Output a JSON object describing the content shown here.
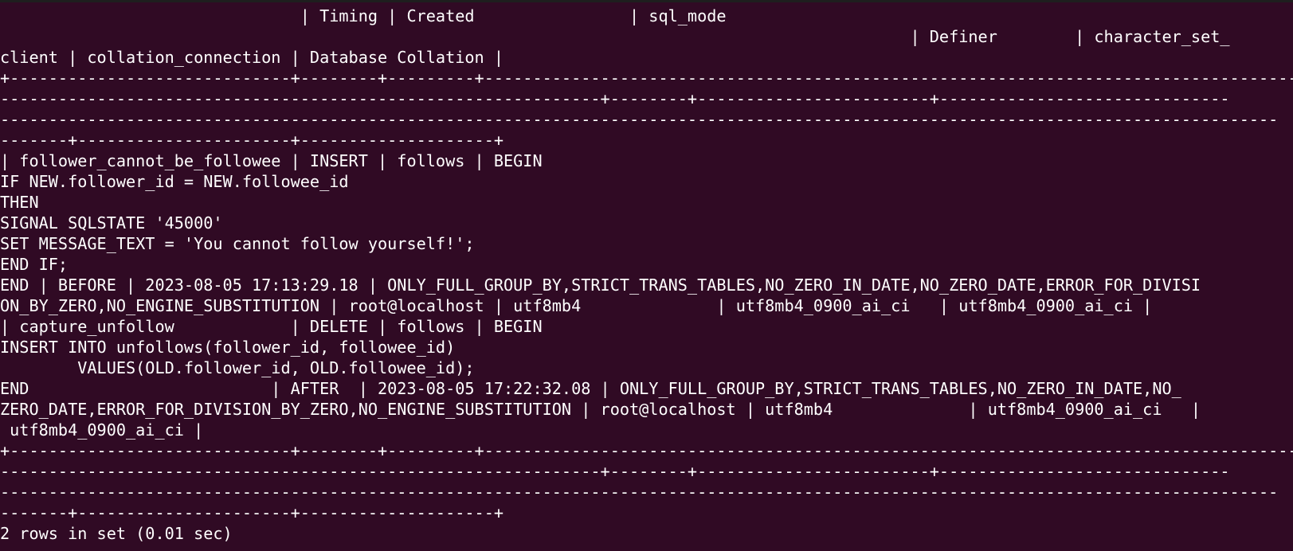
{
  "terminal": {
    "lines": [
      "                               | Timing | Created                | sql_mode",
      "                                                                                              | Definer        | character_set_",
      "client | collation_connection | Database Collation |",
      "+-----------------------------+--------+---------+----------------------------------------------------------------------------------------------------------------------------------",
      "--------------------------------------------------------------+--------+------------------------+------------------------------",
      "------------------------------------------------------------------------------------------------------------------------------------",
      "-------+----------------------+--------------------+",
      "| follower_cannot_be_followee | INSERT | follows | BEGIN",
      "IF NEW.follower_id = NEW.followee_id",
      "THEN",
      "SIGNAL SQLSTATE '45000'",
      "SET MESSAGE_TEXT = 'You cannot follow yourself!';",
      "END IF;",
      "END | BEFORE | 2023-08-05 17:13:29.18 | ONLY_FULL_GROUP_BY,STRICT_TRANS_TABLES,NO_ZERO_IN_DATE,NO_ZERO_DATE,ERROR_FOR_DIVISI",
      "ON_BY_ZERO,NO_ENGINE_SUBSTITUTION | root@localhost | utf8mb4              | utf8mb4_0900_ai_ci   | utf8mb4_0900_ai_ci |",
      "| capture_unfollow            | DELETE | follows | BEGIN",
      "INSERT INTO unfollows(follower_id, followee_id)",
      "        VALUES(OLD.follower_id, OLD.followee_id);",
      "END                         | AFTER  | 2023-08-05 17:22:32.08 | ONLY_FULL_GROUP_BY,STRICT_TRANS_TABLES,NO_ZERO_IN_DATE,NO_",
      "ZERO_DATE,ERROR_FOR_DIVISION_BY_ZERO,NO_ENGINE_SUBSTITUTION | root@localhost | utf8mb4              | utf8mb4_0900_ai_ci   |",
      " utf8mb4_0900_ai_ci |",
      "+-----------------------------+--------+---------+----------------------------------------------------------------------------------------------------------------------------------",
      "--------------------------------------------------------------+--------+------------------------+------------------------------",
      "------------------------------------------------------------------------------------------------------------------------------------",
      "-------+----------------------+--------------------+",
      "2 rows in set (0.01 sec)"
    ]
  }
}
